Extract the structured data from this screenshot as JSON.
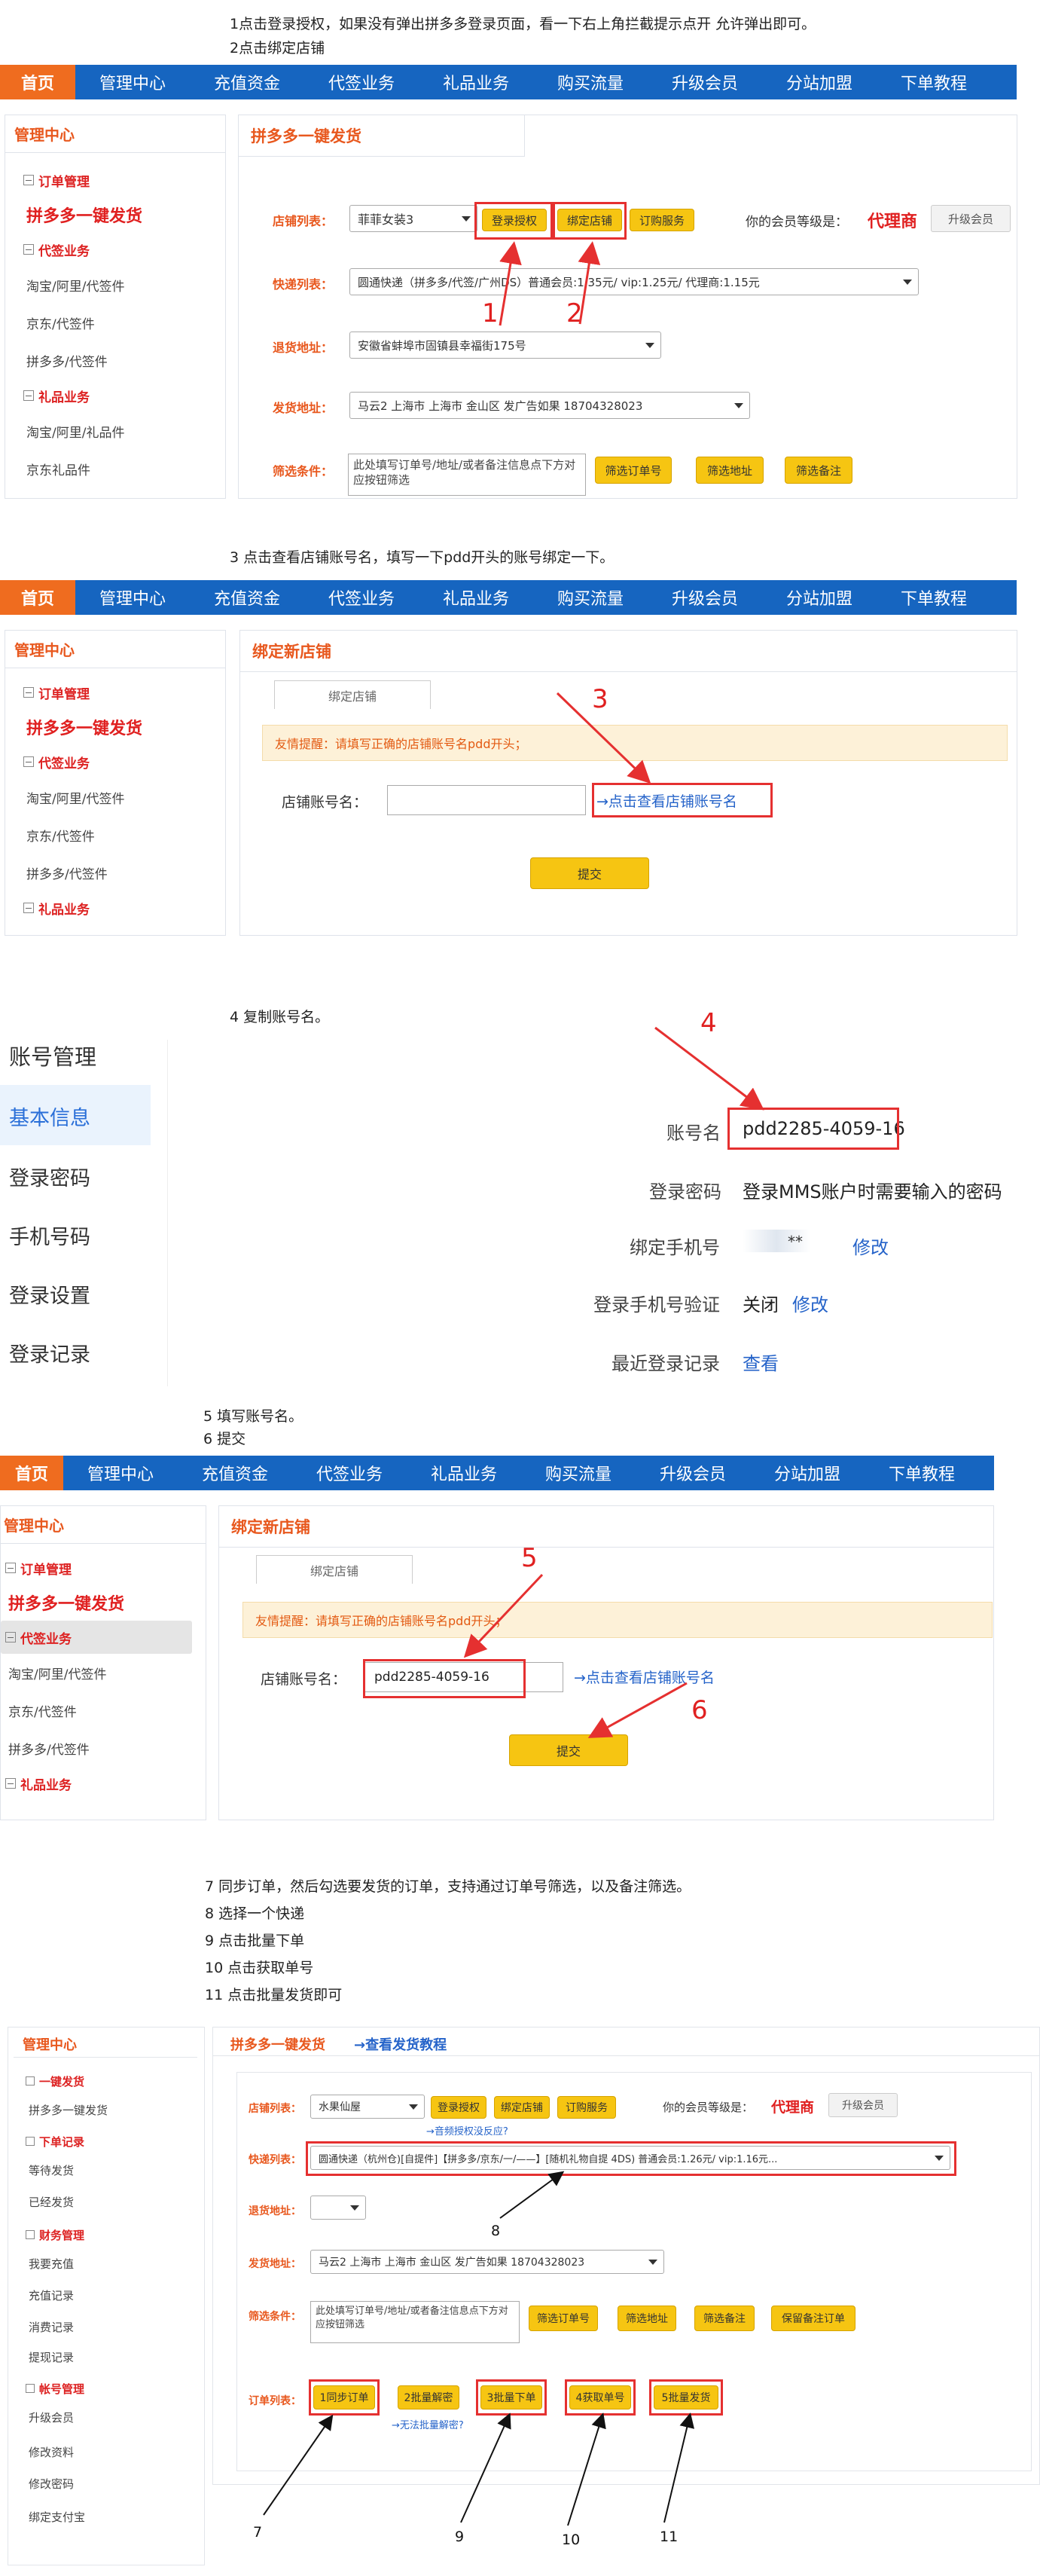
{
  "steps": {
    "s1": "1点击登录授权，如果没有弹出拼多多登录页面，看一下右上角拦截提示点开 允许弹出即可。",
    "s2": "2点击绑定店铺",
    "s3": "3 点击查看店铺账号名，填写一下pdd开头的账号绑定一下。",
    "s4": "4 复制账号名。",
    "s5": "5 填写账号名。",
    "s6": "6 提交",
    "s7": "7 同步订单，然后勾选要发货的订单，支持通过订单号筛选，以及备注筛选。",
    "s8": "8 选择一个快递",
    "s9": "9 点击批量下单",
    "s10": "10 点击获取单号",
    "s11": "11 点击批量发货即可"
  },
  "nav": {
    "home": "首页",
    "items": [
      "管理中心",
      "充值资金",
      "代签业务",
      "礼品业务",
      "购买流量",
      "升级会员",
      "分站加盟",
      "下单教程"
    ]
  },
  "sidebar": {
    "title": "管理中心",
    "order_mgmt": "订单管理",
    "pdd_send": "拼多多一键发货",
    "daiqian": "代签业务",
    "taobao": "淘宝/阿里/代签件",
    "jd": "京东/代签件",
    "pdd": "拼多多/代签件",
    "gift": "礼品业务",
    "taobao_gift": "淘宝/阿里/礼品件",
    "jd_gift": "京东礼品件"
  },
  "panel1": {
    "title": "拼多多一键发货",
    "shop_label": "店铺列表：",
    "shop_value": "菲菲女装3",
    "login_btn": "登录授权",
    "bind_btn": "绑定店铺",
    "service_btn": "订购服务",
    "member_text": "你的会员等级是：",
    "member_level": "代理商",
    "upgrade_btn": "升级会员",
    "express_label": "快递列表：",
    "express_value": "圆通快递（拼多多/代签/广州DS）普通会员:1.35元/ vip:1.25元/ 代理商:1.15元",
    "return_label": "退货地址：",
    "return_value": "安徽省蚌埠市固镇县幸福街175号",
    "send_label": "发货地址：",
    "send_value": "马云2 上海市 上海市 金山区 发广告如果 18704328023",
    "filter_label": "筛选条件：",
    "filter_placeholder": "此处填写订单号/地址/或者备注信息点下方对应按钮筛选",
    "filter_order": "筛选订单号",
    "filter_addr": "筛选地址",
    "filter_note": "筛选备注",
    "num1": "1",
    "num2": "2"
  },
  "panel2": {
    "title": "绑定新店铺",
    "tab": "绑定店铺",
    "tip": "友情提醒：请填写正确的店铺账号名pdd开头；",
    "field_label": "店铺账号名：",
    "link": "→点击查看店铺账号名",
    "submit": "提交",
    "num3": "3"
  },
  "account": {
    "title": "账号管理",
    "menu": [
      "基本信息",
      "登录密码",
      "手机号码",
      "登录设置",
      "登录记录"
    ],
    "name_label": "账号名",
    "name_value": "pdd2285-4059-16",
    "pwd_label": "登录密码",
    "pwd_value": "登录MMS账户时需要输入的密码",
    "phone_label": "绑定手机号",
    "phone_value": "**",
    "phone_edit": "修改",
    "verify_label": "登录手机号验证",
    "verify_value": "关闭",
    "verify_edit": "修改",
    "record_label": "最近登录记录",
    "record_link": "查看",
    "num4": "4"
  },
  "panel3": {
    "value": "pdd2285-4059-16",
    "num5": "5",
    "num6": "6"
  },
  "panel4": {
    "title": "拼多多一键发货",
    "tutorial": "→查看发货教程",
    "sidebar": {
      "title": "管理中心",
      "g1": "一键发货",
      "i1": "拼多多一键发货",
      "g2": "下单记录",
      "i2": "等待发货",
      "i3": "已经发货",
      "g3": "财务管理",
      "i4": "我要充值",
      "i5": "充值记录",
      "i6": "消费记录",
      "i7": "提现记录",
      "g4": "帐号管理",
      "i8": "升级会员",
      "i9": "修改资料",
      "i10": "修改密码",
      "i11": "绑定支付宝"
    },
    "shop_value": "水果仙屋",
    "login_btn": "登录授权",
    "bind_btn": "绑定店铺",
    "service_btn": "订购服务",
    "auth_link": "→音频授权没反应?",
    "member_text": "你的会员等级是：",
    "member_level": "代理商",
    "upgrade_btn": "升级会员",
    "express_label": "快递列表：",
    "express_value": "圆通快递（杭州仓)[自提件]【拼多多/京东/一/——】[随机礼物自提 4DS) 普通会员:1.26元/ vip:1.16元...",
    "return_label": "退货地址：",
    "send_label": "发货地址：",
    "send_value": "马云2 上海市 上海市 金山区 发广告如果 18704328023",
    "filter_label": "筛选条件：",
    "filter_placeholder": "此处填写订单号/地址/或者备注信息点下方对应按钮筛选",
    "filter_order": "筛选订单号",
    "filter_addr": "筛选地址",
    "filter_note": "筛选备注",
    "filter_keep": "保留备注订单",
    "list_label": "订单列表：",
    "b1": "1同步订单",
    "b2": "2批量解密",
    "b3": "3批量下单",
    "b4": "4获取单号",
    "b5": "5批量发货",
    "decrypt_link": "→无法批量解密?",
    "n7": "7",
    "n8": "8",
    "n9": "9",
    "n10": "10",
    "n11": "11"
  }
}
